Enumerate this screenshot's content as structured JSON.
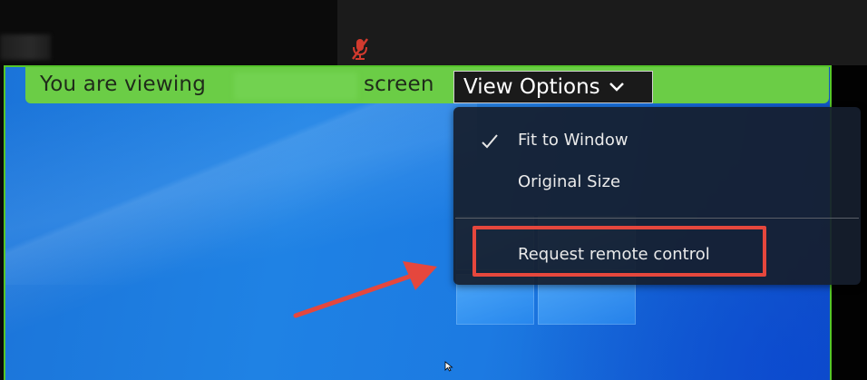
{
  "banner": {
    "viewing_prefix": "You are viewing",
    "viewing_suffix": "screen",
    "view_options_label": "View Options"
  },
  "menu": {
    "items": [
      {
        "label": "Fit to Window",
        "checked": true
      },
      {
        "label": "Original Size",
        "checked": false
      },
      {
        "label": "Request remote control",
        "checked": false
      }
    ]
  },
  "colors": {
    "banner_green": "#6bcd46",
    "frame_green": "#55c52a",
    "highlight_red": "#e5473d",
    "menu_bg": "#161e2d"
  },
  "icons": [
    "muted-microphone-icon",
    "chevron-down-icon",
    "checkmark-icon",
    "arrow-annotation-icon",
    "mouse-cursor-icon"
  ]
}
